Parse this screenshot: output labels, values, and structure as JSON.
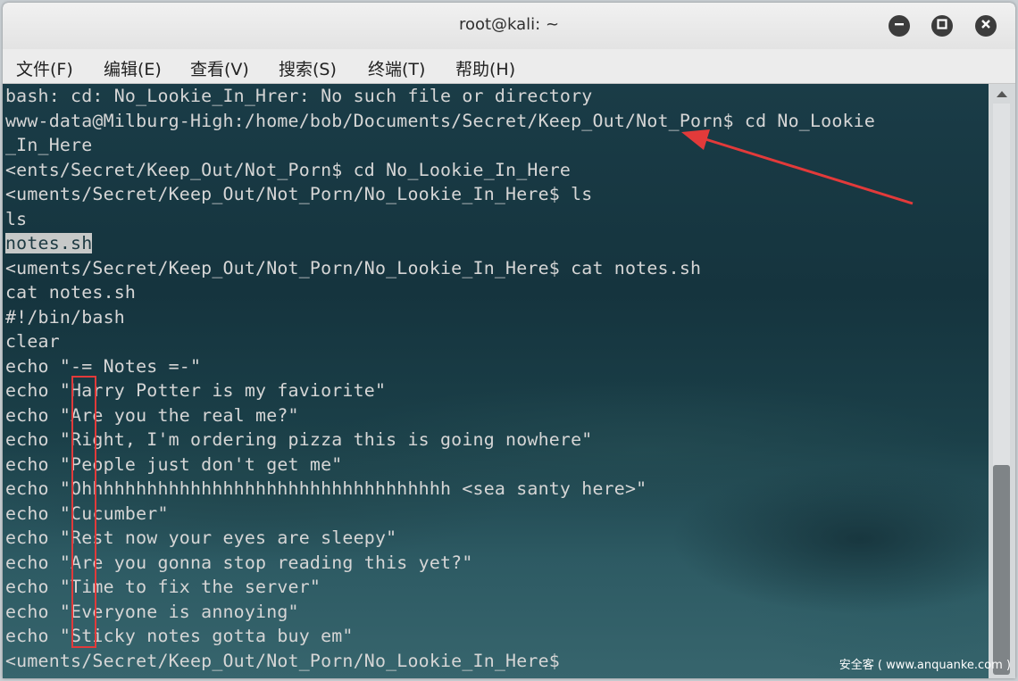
{
  "window": {
    "title": "root@kali: ~"
  },
  "window_controls": {
    "minimize_icon": "minus",
    "maximize_icon": "square",
    "close_icon": "x"
  },
  "menu": {
    "file": "文件(F)",
    "edit": "编辑(E)",
    "view": "查看(V)",
    "search": "搜索(S)",
    "terminal": "终端(T)",
    "help": "帮助(H)"
  },
  "terminal": {
    "lines": [
      "bash: cd: No_Lookie_In_Hrer: No such file or directory",
      "www-data@Milburg-High:/home/bob/Documents/Secret/Keep_Out/Not_Porn$ cd No_Lookie",
      "_In_Here",
      "<ents/Secret/Keep_Out/Not_Porn$ cd No_Lookie_In_Here",
      "<uments/Secret/Keep_Out/Not_Porn/No_Lookie_In_Here$ ls",
      "ls",
      "notes.sh",
      "<uments/Secret/Keep_Out/Not_Porn/No_Lookie_In_Here$ cat notes.sh",
      "cat notes.sh",
      "#!/bin/bash",
      "clear",
      "echo \"-= Notes =-\"",
      "echo \"Harry Potter is my faviorite\"",
      "echo \"Are you the real me?\"",
      "echo \"Right, I'm ordering pizza this is going nowhere\"",
      "echo \"People just don't get me\"",
      "echo \"Ohhhhhhhhhhhhhhhhhhhhhhhhhhhhhhhhhh <sea santy here>\"",
      "echo \"Cucumber\"",
      "echo \"Rest now your eyes are sleepy\"",
      "echo \"Are you gonna stop reading this yet?\"",
      "echo \"Time to fix the server\"",
      "echo \"Everyone is annoying\"",
      "echo \"Sticky notes gotta buy em\"",
      "<uments/Secret/Keep_Out/Not_Porn/No_Lookie_In_Here$"
    ]
  },
  "annotations": {
    "color": "#e23a3a"
  },
  "watermark": "安全客 ( www.anquanke.com )"
}
